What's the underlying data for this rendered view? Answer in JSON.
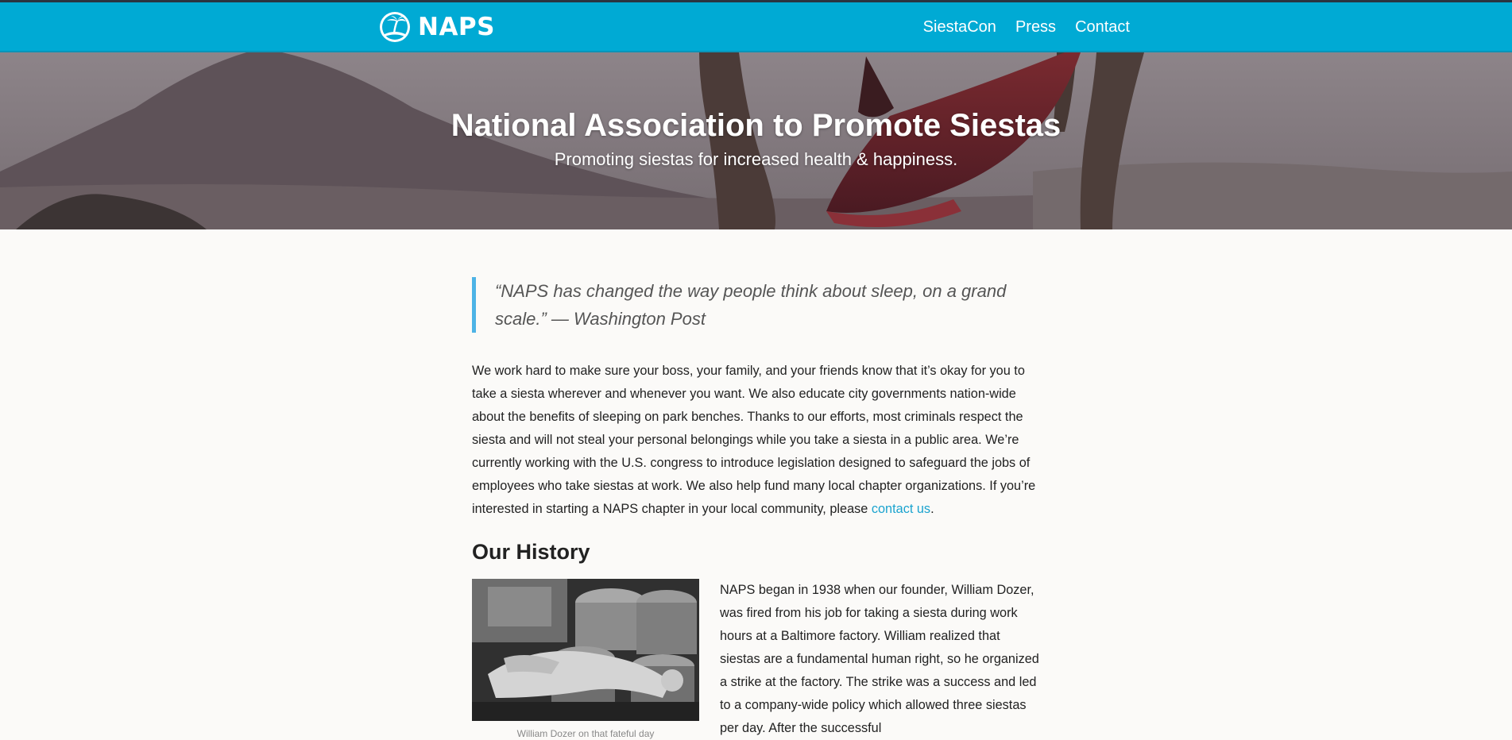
{
  "nav": {
    "logo_text": "NAPS",
    "links": [
      {
        "label": "SiestaCon"
      },
      {
        "label": "Press"
      },
      {
        "label": "Contact"
      }
    ]
  },
  "hero": {
    "title": "National Association to Promote Siestas",
    "subtitle": "Promoting siestas for increased health & happiness."
  },
  "quote": {
    "line1": "“NAPS has changed the way people think about sleep, on a grand",
    "line2": "scale.” — Washington Post"
  },
  "about": {
    "text": "We work hard to make sure your boss, your family, and your friends know that it’s okay for you to take a siesta wherever and whenever you want. We also educate city governments nation-wide about the benefits of sleeping on park benches. Thanks to our efforts, most criminals respect the siesta and will not steal your personal belongings while you take a siesta in a public area. We’re currently working with the U.S. congress to introduce legislation designed to safeguard the jobs of employees who take siestas at work. We also help fund many local chapter organizations. If you’re interested in starting a NAPS chapter in your local community, please ",
    "link_text": "contact us",
    "end": "."
  },
  "history": {
    "heading": "Our History",
    "caption": "William Dozer on that fateful day",
    "text": "NAPS began in 1938 when our founder, William Dozer, was fired from his job for taking a siesta during work hours at a Baltimore factory. William realized that siestas are a fundamental human right, so he organized a strike at the factory. The strike was a success and led to a company-wide policy which allowed three siestas per day. After the successful"
  },
  "colors": {
    "nav_background": "#00aad4",
    "link": "#1aa3cf",
    "quote_border": "#4db3e6"
  }
}
